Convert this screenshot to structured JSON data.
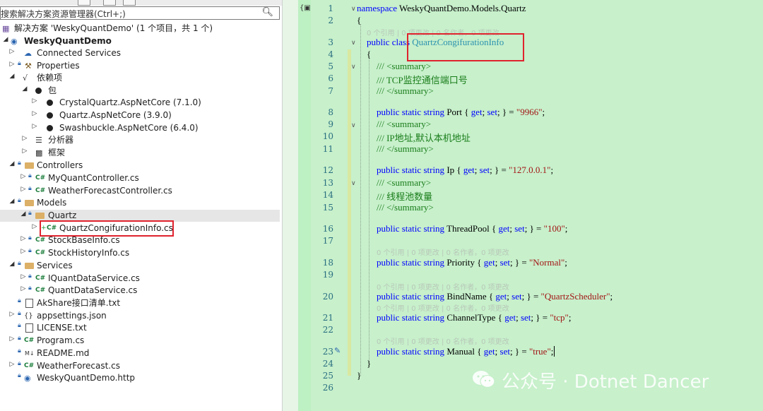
{
  "explorer": {
    "search_placeholder": "搜索解决方案资源管理器(Ctrl+;)",
    "solution_title": "解决方案 'WeskyQuantDemo' (1 个项目，共 1 个)",
    "project_name": "WeskyQuantDemo",
    "items": {
      "connected": "Connected Services",
      "properties": "Properties",
      "deps": "依赖项",
      "pkg": "包",
      "crystal": "CrystalQuartz.AspNetCore (7.1.0)",
      "quartz_pkg": "Quartz.AspNetCore (3.9.0)",
      "swash": "Swashbuckle.AspNetCore (6.4.0)",
      "analyzers": "分析器",
      "frameworks": "框架",
      "controllers": "Controllers",
      "myquant": "MyQuantController.cs",
      "weatherctl": "WeatherForecastController.cs",
      "models": "Models",
      "quartz_folder": "Quartz",
      "qcfg": "QuartzCongifurationInfo.cs",
      "stockbase": "StockBaseInfo.cs",
      "stockhist": "StockHistoryInfo.cs",
      "services": "Services",
      "iquant": "IQuantDataService.cs",
      "quantsvc": "QuantDataService.cs",
      "akshare": "AkShare接口清单.txt",
      "appsettings": "appsettings.json",
      "license": "LICENSE.txt",
      "program": "Program.cs",
      "readme": "README.md",
      "weatherfc": "WeatherForecast.cs",
      "http": "WeskyQuantDemo.http"
    }
  },
  "editor": {
    "line_numbers": [
      "1",
      "2",
      "3",
      "4",
      "5",
      "6",
      "7",
      "8",
      "9",
      "10",
      "11",
      "12",
      "13",
      "14",
      "15",
      "16",
      "17",
      "18",
      "19",
      "20",
      "21",
      "22",
      "23",
      "24",
      "25",
      "26"
    ],
    "lens": "0 个引用 | 0 项更改 | 0 名作者，0 项更改",
    "code": {
      "ns_kw": "namespace",
      "ns_name": " WeskyQuantDemo.Models.Quartz",
      "brace_open": "{",
      "brace_close": "}",
      "class_kw": "public class",
      "class_name": "QuartzCongifurationInfo",
      "summary_open": "/// <summary>",
      "summary_close": "/// </summary>",
      "c_port": "/// TCP监控通信端口号",
      "c_ip": "/// IP地址,默认本机地址",
      "c_thread": "/// 线程池数量",
      "decl_kw": "public static",
      "string_kw": "string",
      "get_kw": "get",
      "set_kw": "set",
      "port_name": "Port",
      "port_val": "\"9966\"",
      "ip_name": "Ip",
      "ip_val": "\"127.0.0.1\"",
      "thread_name": "ThreadPool",
      "thread_val": "\"100\"",
      "prio_name": "Priority",
      "prio_val": "\"Normal\"",
      "bind_name": "BindName",
      "bind_val": "\"QuartzScheduler\"",
      "chan_name": "ChannelType",
      "chan_val": "\"tcp\"",
      "manual_name": "Manual",
      "manual_val": "\"true\""
    }
  },
  "watermark": "公众号 · Dotnet Dancer",
  "colors": {
    "editor_bg": "#c7f0cb",
    "keyword": "#0000ff",
    "comment": "#1a7d1a",
    "string": "#a31515",
    "type": "#2b91af",
    "highlight_box": "#e0232e"
  }
}
